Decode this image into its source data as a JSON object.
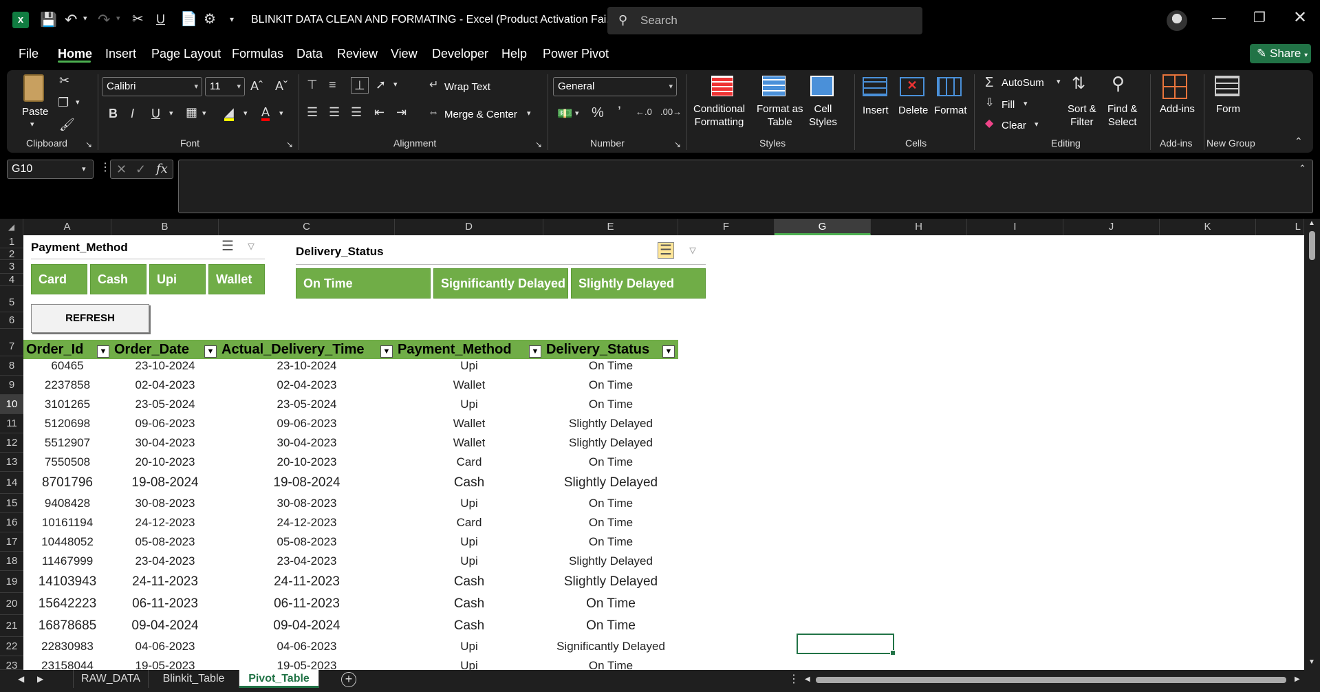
{
  "titlebar": {
    "title": "BLINKIT DATA CLEAN AND FORMATING  -  Excel (Product Activation Fai...",
    "search_placeholder": "Search"
  },
  "menu": {
    "items": [
      "File",
      "Home",
      "Insert",
      "Page Layout",
      "Formulas",
      "Data",
      "Review",
      "View",
      "Developer",
      "Help",
      "Power Pivot"
    ],
    "share": "Share"
  },
  "ribbon": {
    "clipboard": {
      "paste": "Paste",
      "label": "Clipboard"
    },
    "font": {
      "name": "Calibri",
      "size": "11",
      "label": "Font"
    },
    "alignment": {
      "wrap": "Wrap Text",
      "merge": "Merge & Center",
      "label": "Alignment"
    },
    "number": {
      "format": "General",
      "label": "Number"
    },
    "styles": {
      "conditional": "Conditional\nFormatting",
      "format_table": "Format as\nTable",
      "cell_styles": "Cell\nStyles",
      "label": "Styles"
    },
    "cells": {
      "insert": "Insert",
      "delete": "Delete",
      "format": "Format",
      "label": "Cells"
    },
    "editing": {
      "autosum": "AutoSum",
      "fill": "Fill",
      "clear": "Clear",
      "sort": "Sort &\nFilter",
      "find": "Find &\nSelect",
      "label": "Editing"
    },
    "addins": {
      "addins": "Add-ins",
      "label": "Add-ins"
    },
    "newgroup": {
      "form": "Form",
      "label": "New Group"
    }
  },
  "formula_bar": {
    "namebox": "G10",
    "fx": "fx",
    "content": ""
  },
  "columns": [
    "A",
    "B",
    "C",
    "D",
    "E",
    "F",
    "G",
    "H",
    "I",
    "J",
    "K",
    "L"
  ],
  "selected_column": "G",
  "rows": [
    "1",
    "2",
    "3",
    "4",
    "5",
    "6",
    "7",
    "8",
    "9",
    "10",
    "11",
    "12",
    "13",
    "14",
    "15",
    "16",
    "17",
    "18",
    "19",
    "20",
    "21",
    "22",
    "23"
  ],
  "selected_row": "10",
  "slicers": {
    "payment": {
      "title": "Payment_Method",
      "buttons": [
        "Card",
        "Cash",
        "Upi",
        "Wallet"
      ]
    },
    "delivery": {
      "title": "Delivery_Status",
      "buttons": [
        "On Time",
        "Significantly Delayed",
        "Slightly Delayed"
      ]
    }
  },
  "refresh_label": "REFRESH",
  "table": {
    "headers": [
      "Order_Id",
      "Order_Date",
      "Actual_Delivery_Time",
      "Payment_Method",
      "Delivery_Status"
    ],
    "rows": [
      [
        "60465",
        "23-10-2024",
        "23-10-2024",
        "Upi",
        "On Time"
      ],
      [
        "2237858",
        "02-04-2023",
        "02-04-2023",
        "Wallet",
        "On Time"
      ],
      [
        "3101265",
        "23-05-2024",
        "23-05-2024",
        "Upi",
        "On Time"
      ],
      [
        "5120698",
        "09-06-2023",
        "09-06-2023",
        "Wallet",
        "Slightly Delayed"
      ],
      [
        "5512907",
        "30-04-2023",
        "30-04-2023",
        "Wallet",
        "Slightly Delayed"
      ],
      [
        "7550508",
        "20-10-2023",
        "20-10-2023",
        "Card",
        "On Time"
      ],
      [
        "8701796",
        "19-08-2024",
        "19-08-2024",
        "Cash",
        "Slightly Delayed"
      ],
      [
        "9408428",
        "30-08-2023",
        "30-08-2023",
        "Upi",
        "On Time"
      ],
      [
        "10161194",
        "24-12-2023",
        "24-12-2023",
        "Card",
        "On Time"
      ],
      [
        "10448052",
        "05-08-2023",
        "05-08-2023",
        "Upi",
        "On Time"
      ],
      [
        "11467999",
        "23-04-2023",
        "23-04-2023",
        "Upi",
        "Slightly Delayed"
      ],
      [
        "14103943",
        "24-11-2023",
        "24-11-2023",
        "Cash",
        "Slightly Delayed"
      ],
      [
        "15642223",
        "06-11-2023",
        "06-11-2023",
        "Cash",
        "On Time"
      ],
      [
        "16878685",
        "09-04-2024",
        "09-04-2024",
        "Cash",
        "On Time"
      ],
      [
        "22830983",
        "04-06-2023",
        "04-06-2023",
        "Upi",
        "Significantly Delayed"
      ],
      [
        "23158044",
        "19-05-2023",
        "19-05-2023",
        "Upi",
        "On Time"
      ]
    ]
  },
  "sheet_tabs": [
    "RAW_DATA",
    "Blinkit_Table",
    "Pivot_Table"
  ],
  "active_tab": "Pivot_Table",
  "colors": {
    "accent": "#70ad47",
    "excel_green": "#217346"
  }
}
